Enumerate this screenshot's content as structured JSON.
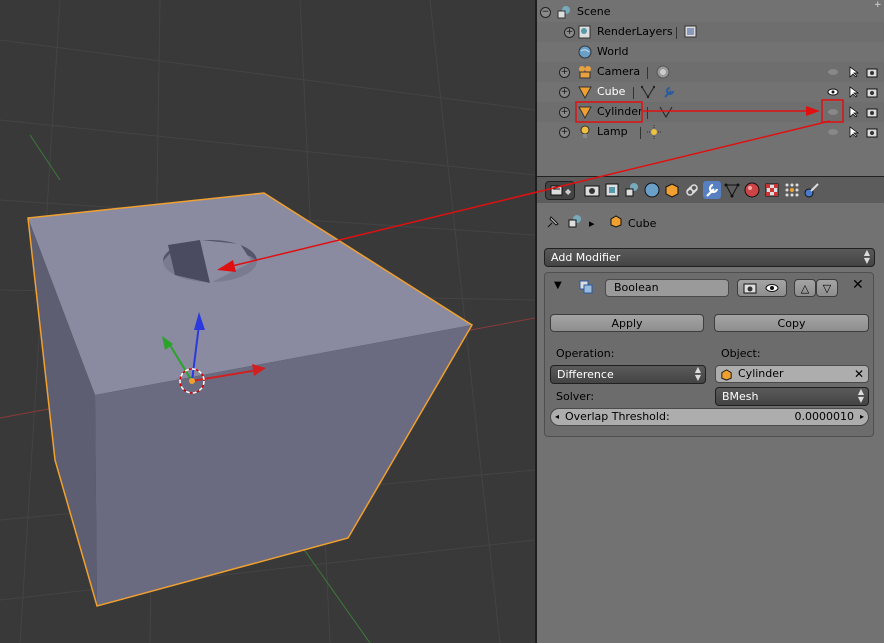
{
  "outliner": {
    "rows": [
      {
        "label": "Scene",
        "icon": "scene-icon"
      },
      {
        "label": "RenderLayers",
        "icon": "render-layers-icon"
      },
      {
        "label": "World",
        "icon": "world-icon"
      },
      {
        "label": "Camera",
        "icon": "camera-object-icon"
      },
      {
        "label": "Cube",
        "icon": "mesh-object-icon"
      },
      {
        "label": "Cylinder",
        "icon": "mesh-object-icon"
      },
      {
        "label": "Lamp",
        "icon": "lamp-object-icon"
      }
    ]
  },
  "properties": {
    "breadcrumb": {
      "object": "Cube"
    },
    "add_modifier_label": "Add Modifier",
    "modifier": {
      "name": "Boolean",
      "apply_label": "Apply",
      "copy_label": "Copy",
      "operation_label": "Operation:",
      "operation_value": "Difference",
      "object_label": "Object:",
      "object_value": "Cylinder",
      "solver_label": "Solver:",
      "solver_value": "BMesh",
      "overlap_label": "Overlap Threshold:",
      "overlap_value": "0.0000010"
    }
  },
  "colors": {
    "annotation_red": "#e01010",
    "selection_orange": "#f0a030",
    "active_tab": "#5680c2",
    "viewport_bg": "#393939"
  }
}
